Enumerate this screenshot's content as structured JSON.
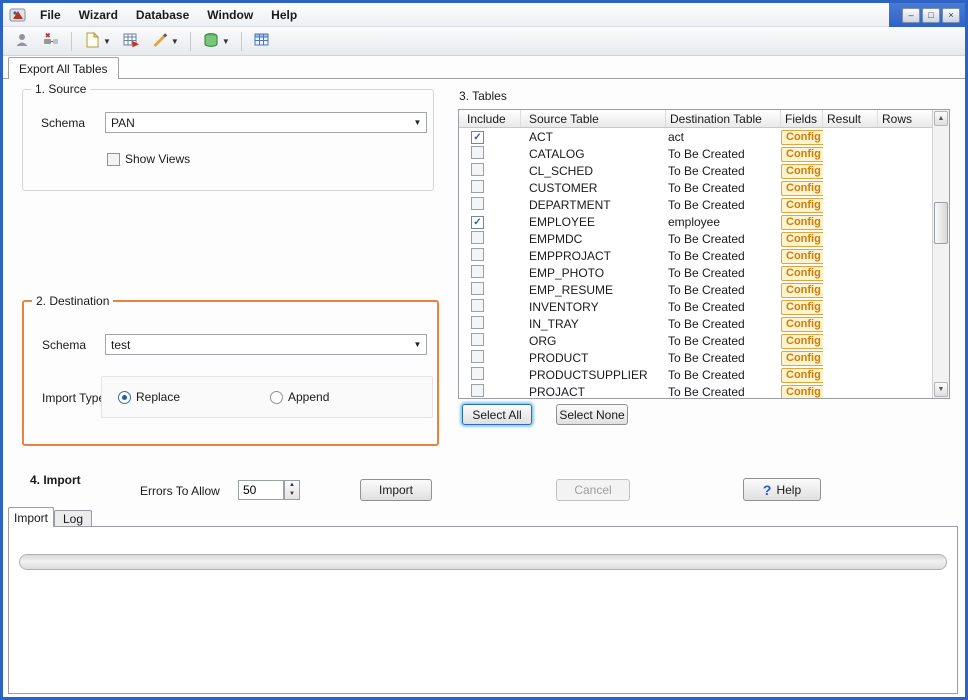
{
  "window": {
    "menu": [
      "File",
      "Wizard",
      "Database",
      "Window",
      "Help"
    ],
    "controls": {
      "minimize": "–",
      "restore": "□",
      "close": "×"
    }
  },
  "main_tab": {
    "label": "Export All Tables"
  },
  "source": {
    "title": "1. Source",
    "schema_label": "Schema",
    "schema_value": "PAN",
    "show_views_label": "Show Views"
  },
  "destination": {
    "title": "2. Destination",
    "schema_label": "Schema",
    "schema_value": "test",
    "import_type_label": "Import Type",
    "replace_label": "Replace",
    "append_label": "Append",
    "selected_import_type": "Replace",
    "highlight_color": "#e8823c"
  },
  "tables": {
    "title": "3. Tables",
    "columns": [
      "Include",
      "Source Table",
      "Destination Table",
      "Fields",
      "Result",
      "Rows"
    ],
    "config_label": "Config",
    "select_all_label": "Select All",
    "select_none_label": "Select None",
    "rows": [
      {
        "include": true,
        "source": "ACT",
        "destination": "act"
      },
      {
        "include": false,
        "source": "CATALOG",
        "destination": "To Be Created"
      },
      {
        "include": false,
        "source": "CL_SCHED",
        "destination": "To Be Created"
      },
      {
        "include": false,
        "source": "CUSTOMER",
        "destination": "To Be Created"
      },
      {
        "include": false,
        "source": "DEPARTMENT",
        "destination": "To Be Created"
      },
      {
        "include": true,
        "source": "EMPLOYEE",
        "destination": "employee"
      },
      {
        "include": false,
        "source": "EMPMDC",
        "destination": "To Be Created"
      },
      {
        "include": false,
        "source": "EMPPROJACT",
        "destination": "To Be Created"
      },
      {
        "include": false,
        "source": "EMP_PHOTO",
        "destination": "To Be Created"
      },
      {
        "include": false,
        "source": "EMP_RESUME",
        "destination": "To Be Created"
      },
      {
        "include": false,
        "source": "INVENTORY",
        "destination": "To Be Created"
      },
      {
        "include": false,
        "source": "IN_TRAY",
        "destination": "To Be Created"
      },
      {
        "include": false,
        "source": "ORG",
        "destination": "To Be Created"
      },
      {
        "include": false,
        "source": "PRODUCT",
        "destination": "To Be Created"
      },
      {
        "include": false,
        "source": "PRODUCTSUPPLIER",
        "destination": "To Be Created"
      },
      {
        "include": false,
        "source": "PROJACT",
        "destination": "To Be Created"
      }
    ]
  },
  "import_section": {
    "title": "4. Import",
    "errors_label": "Errors To Allow",
    "errors_value": "50",
    "import_label": "Import",
    "cancel_label": "Cancel",
    "help_icon": "?",
    "help_label": "Help"
  },
  "bottom_tabs": {
    "import": "Import",
    "log": "Log"
  }
}
